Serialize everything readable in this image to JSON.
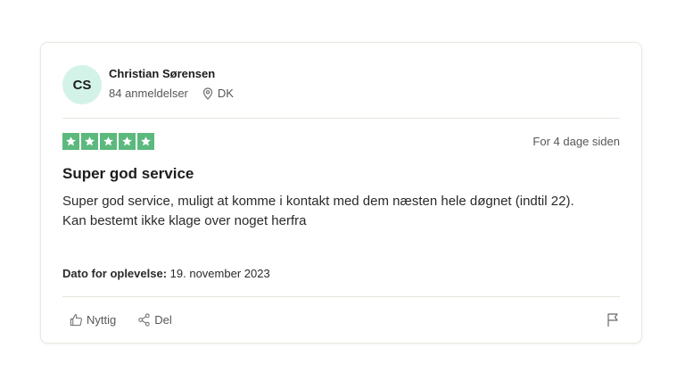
{
  "reviewer": {
    "initials": "CS",
    "name": "Christian Sørensen",
    "review_count": "84 anmeldelser",
    "country": "DK"
  },
  "review": {
    "rating": 5,
    "date_ago": "For 4 dage siden",
    "title": "Super god service",
    "body_line1": "Super god service, muligt at komme i kontakt med dem næsten hele døgnet (indtil 22).",
    "body_line2": "Kan bestemt ikke klage over noget herfra",
    "experience_label": "Dato for oplevelse:",
    "experience_date": "19. november 2023"
  },
  "actions": {
    "helpful_label": "Nyttig",
    "share_label": "Del"
  },
  "colors": {
    "star_green": "#5cb97d",
    "avatar_bg": "#d4f3e8"
  },
  "icons": {
    "location": "location-pin-icon",
    "star": "star-icon",
    "thumbs_up": "thumbs-up-icon",
    "share": "share-icon",
    "flag": "flag-icon"
  }
}
